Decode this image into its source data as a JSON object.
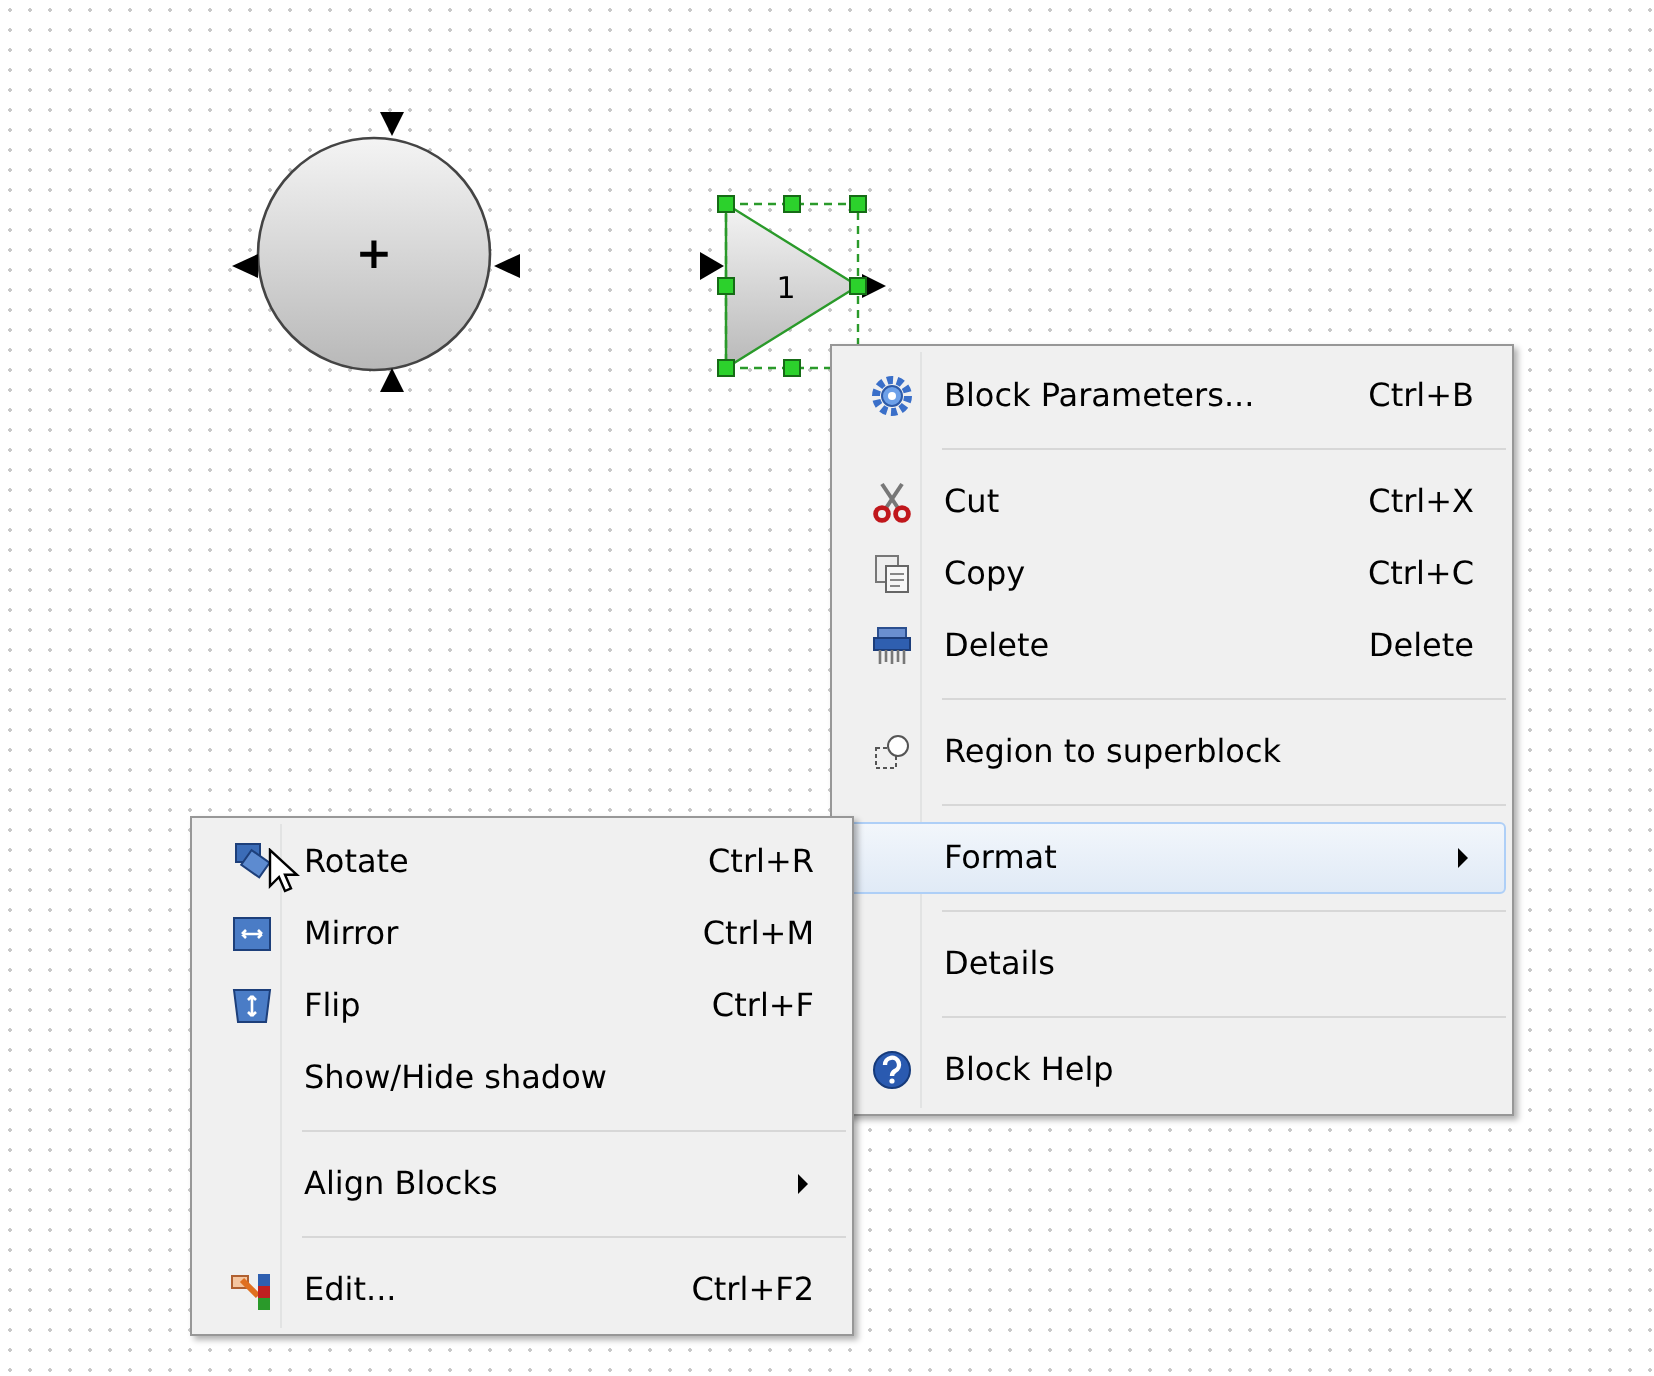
{
  "diagram": {
    "blocks": [
      {
        "kind": "sum",
        "label": "+",
        "selected": false
      },
      {
        "kind": "gain",
        "label": "1",
        "selected": true
      }
    ]
  },
  "context_menu": {
    "items": [
      {
        "kind": "item",
        "label": "Block Parameters...",
        "shortcut": "Ctrl+B",
        "selected": false
      },
      {
        "kind": "separator"
      },
      {
        "kind": "item",
        "label": "Cut",
        "shortcut": "Ctrl+X",
        "selected": false
      },
      {
        "kind": "item",
        "label": "Copy",
        "shortcut": "Ctrl+C",
        "selected": false
      },
      {
        "kind": "item",
        "label": "Delete",
        "shortcut": "Delete",
        "selected": false
      },
      {
        "kind": "separator"
      },
      {
        "kind": "item",
        "label": "Region to superblock",
        "selected": false
      },
      {
        "kind": "separator"
      },
      {
        "kind": "submenu",
        "label": "Format",
        "selected": true
      },
      {
        "kind": "separator"
      },
      {
        "kind": "item",
        "label": "Details",
        "selected": false
      },
      {
        "kind": "separator"
      },
      {
        "kind": "item",
        "label": "Block Help",
        "selected": false
      }
    ]
  },
  "format_submenu": {
    "items": [
      {
        "kind": "item",
        "label": "Rotate",
        "shortcut": "Ctrl+R",
        "selected": false
      },
      {
        "kind": "item",
        "label": "Mirror",
        "shortcut": "Ctrl+M",
        "selected": false
      },
      {
        "kind": "item",
        "label": "Flip",
        "shortcut": "Ctrl+F",
        "selected": false
      },
      {
        "kind": "item",
        "label": "Show/Hide shadow",
        "selected": false
      },
      {
        "kind": "separator"
      },
      {
        "kind": "submenu",
        "label": "Align Blocks",
        "selected": false
      },
      {
        "kind": "separator"
      },
      {
        "kind": "item",
        "label": "Edit...",
        "shortcut": "Ctrl+F2",
        "selected": false
      }
    ]
  }
}
